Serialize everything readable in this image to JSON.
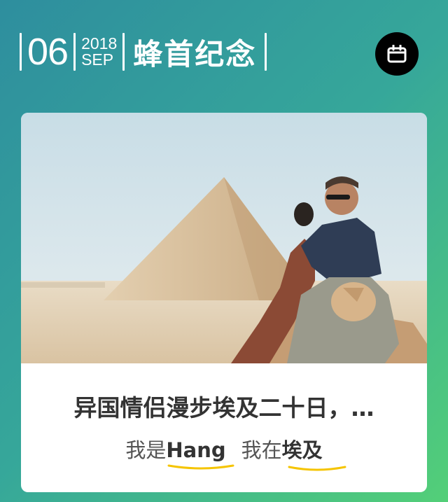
{
  "header": {
    "day": "06",
    "year": "2018",
    "month": "SEP",
    "title": "蜂首纪念"
  },
  "actions": {
    "calendar_icon": "calendar-icon"
  },
  "card": {
    "image_icon": "photo-couple-pyramid",
    "title": "异国情侣漫步埃及二十日，…",
    "subtitle": {
      "prefix": "我是",
      "name": "Hang",
      "middle": "我在",
      "place": "埃及"
    }
  },
  "colors": {
    "bg_start": "#2e8e9e",
    "bg_end": "#53cf78",
    "underline": "#f5c400",
    "button": "#000000"
  }
}
